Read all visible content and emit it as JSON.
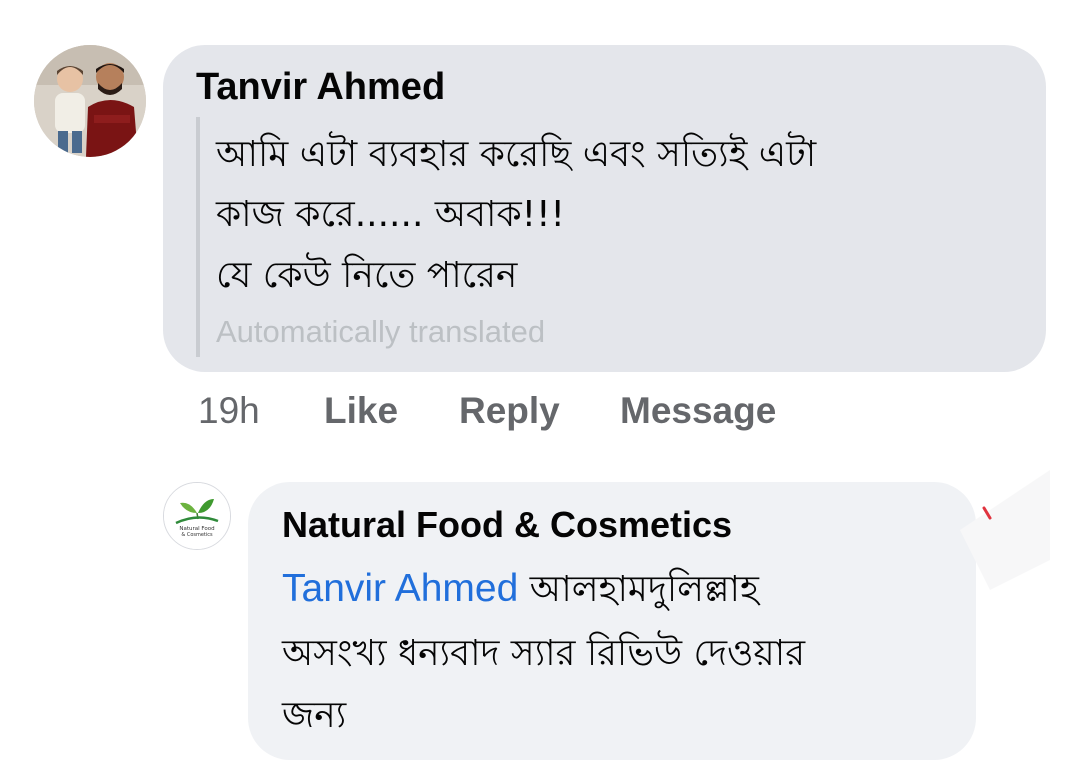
{
  "comment": {
    "author": "Tanvir Ahmed",
    "lines": [
      "আমি এটা ব্যবহার করেছি এবং সত্যিই এটা",
      "কাজ করে...... অবাক!!!",
      "যে কেউ নিতে পারেন"
    ],
    "translation_note": "Automatically translated",
    "time": "19h",
    "actions": {
      "like": "Like",
      "reply": "Reply",
      "message": "Message"
    }
  },
  "reply": {
    "author": "Natural Food & Cosmetics",
    "mention": "Tanvir Ahmed",
    "lines": [
      "আলহামদুলিল্লাহ",
      "অসংখ্য ধন্যবাদ স্যার রিভিউ দেওয়ার",
      "জন্য"
    ],
    "avatar_logo_text": [
      "Natural Food",
      "& Cosmetics"
    ]
  },
  "colors": {
    "bubble_main": "#e4e6eb",
    "bubble_reply": "#f0f2f5",
    "mention_link": "#216fdb",
    "secondary_text": "#65676b",
    "translated_text": "#bcc0c4"
  },
  "icons": {
    "author_avatar": "profile-photo",
    "page_avatar": "leaf-logo"
  }
}
